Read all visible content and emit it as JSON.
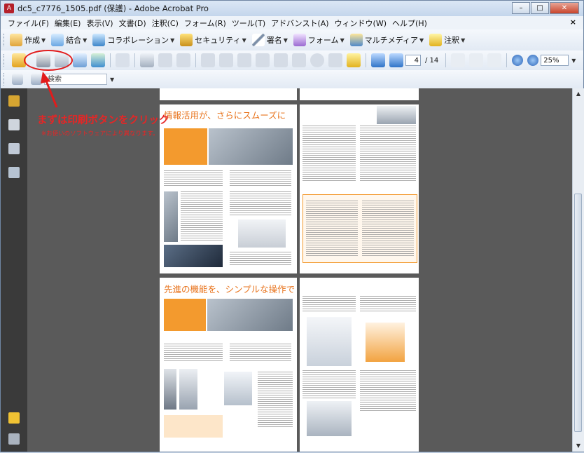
{
  "window": {
    "title": "dc5_c7776_1505.pdf (保護) - Adobe Acrobat Pro"
  },
  "menu": [
    "ファイル(F)",
    "編集(E)",
    "表示(V)",
    "文書(D)",
    "注釈(C)",
    "フォーム(R)",
    "ツール(T)",
    "アドバンスト(A)",
    "ウィンドウ(W)",
    "ヘルプ(H)"
  ],
  "tasks": {
    "create": "作成",
    "combine": "結合",
    "collaborate": "コラボレーション",
    "security": "セキュリティ",
    "sign": "署名",
    "forms": "フォーム",
    "multimedia": "マルチメディア",
    "comment": "注釈"
  },
  "nav": {
    "page_current": "4",
    "page_total": "/ 14",
    "zoom": "25%"
  },
  "search": {
    "placeholder": "検索"
  },
  "annotation": {
    "title": "まずは印刷ボタンをクリック",
    "note": "※お使いのソフトウェアにより異なります。"
  },
  "pages": {
    "p1_title": "情報活用が、さらにスムーズに",
    "p3_title": "先進の機能を、シンプルな操作で"
  },
  "colors": {
    "accent": "#e8731c",
    "annotation": "#e52626"
  }
}
